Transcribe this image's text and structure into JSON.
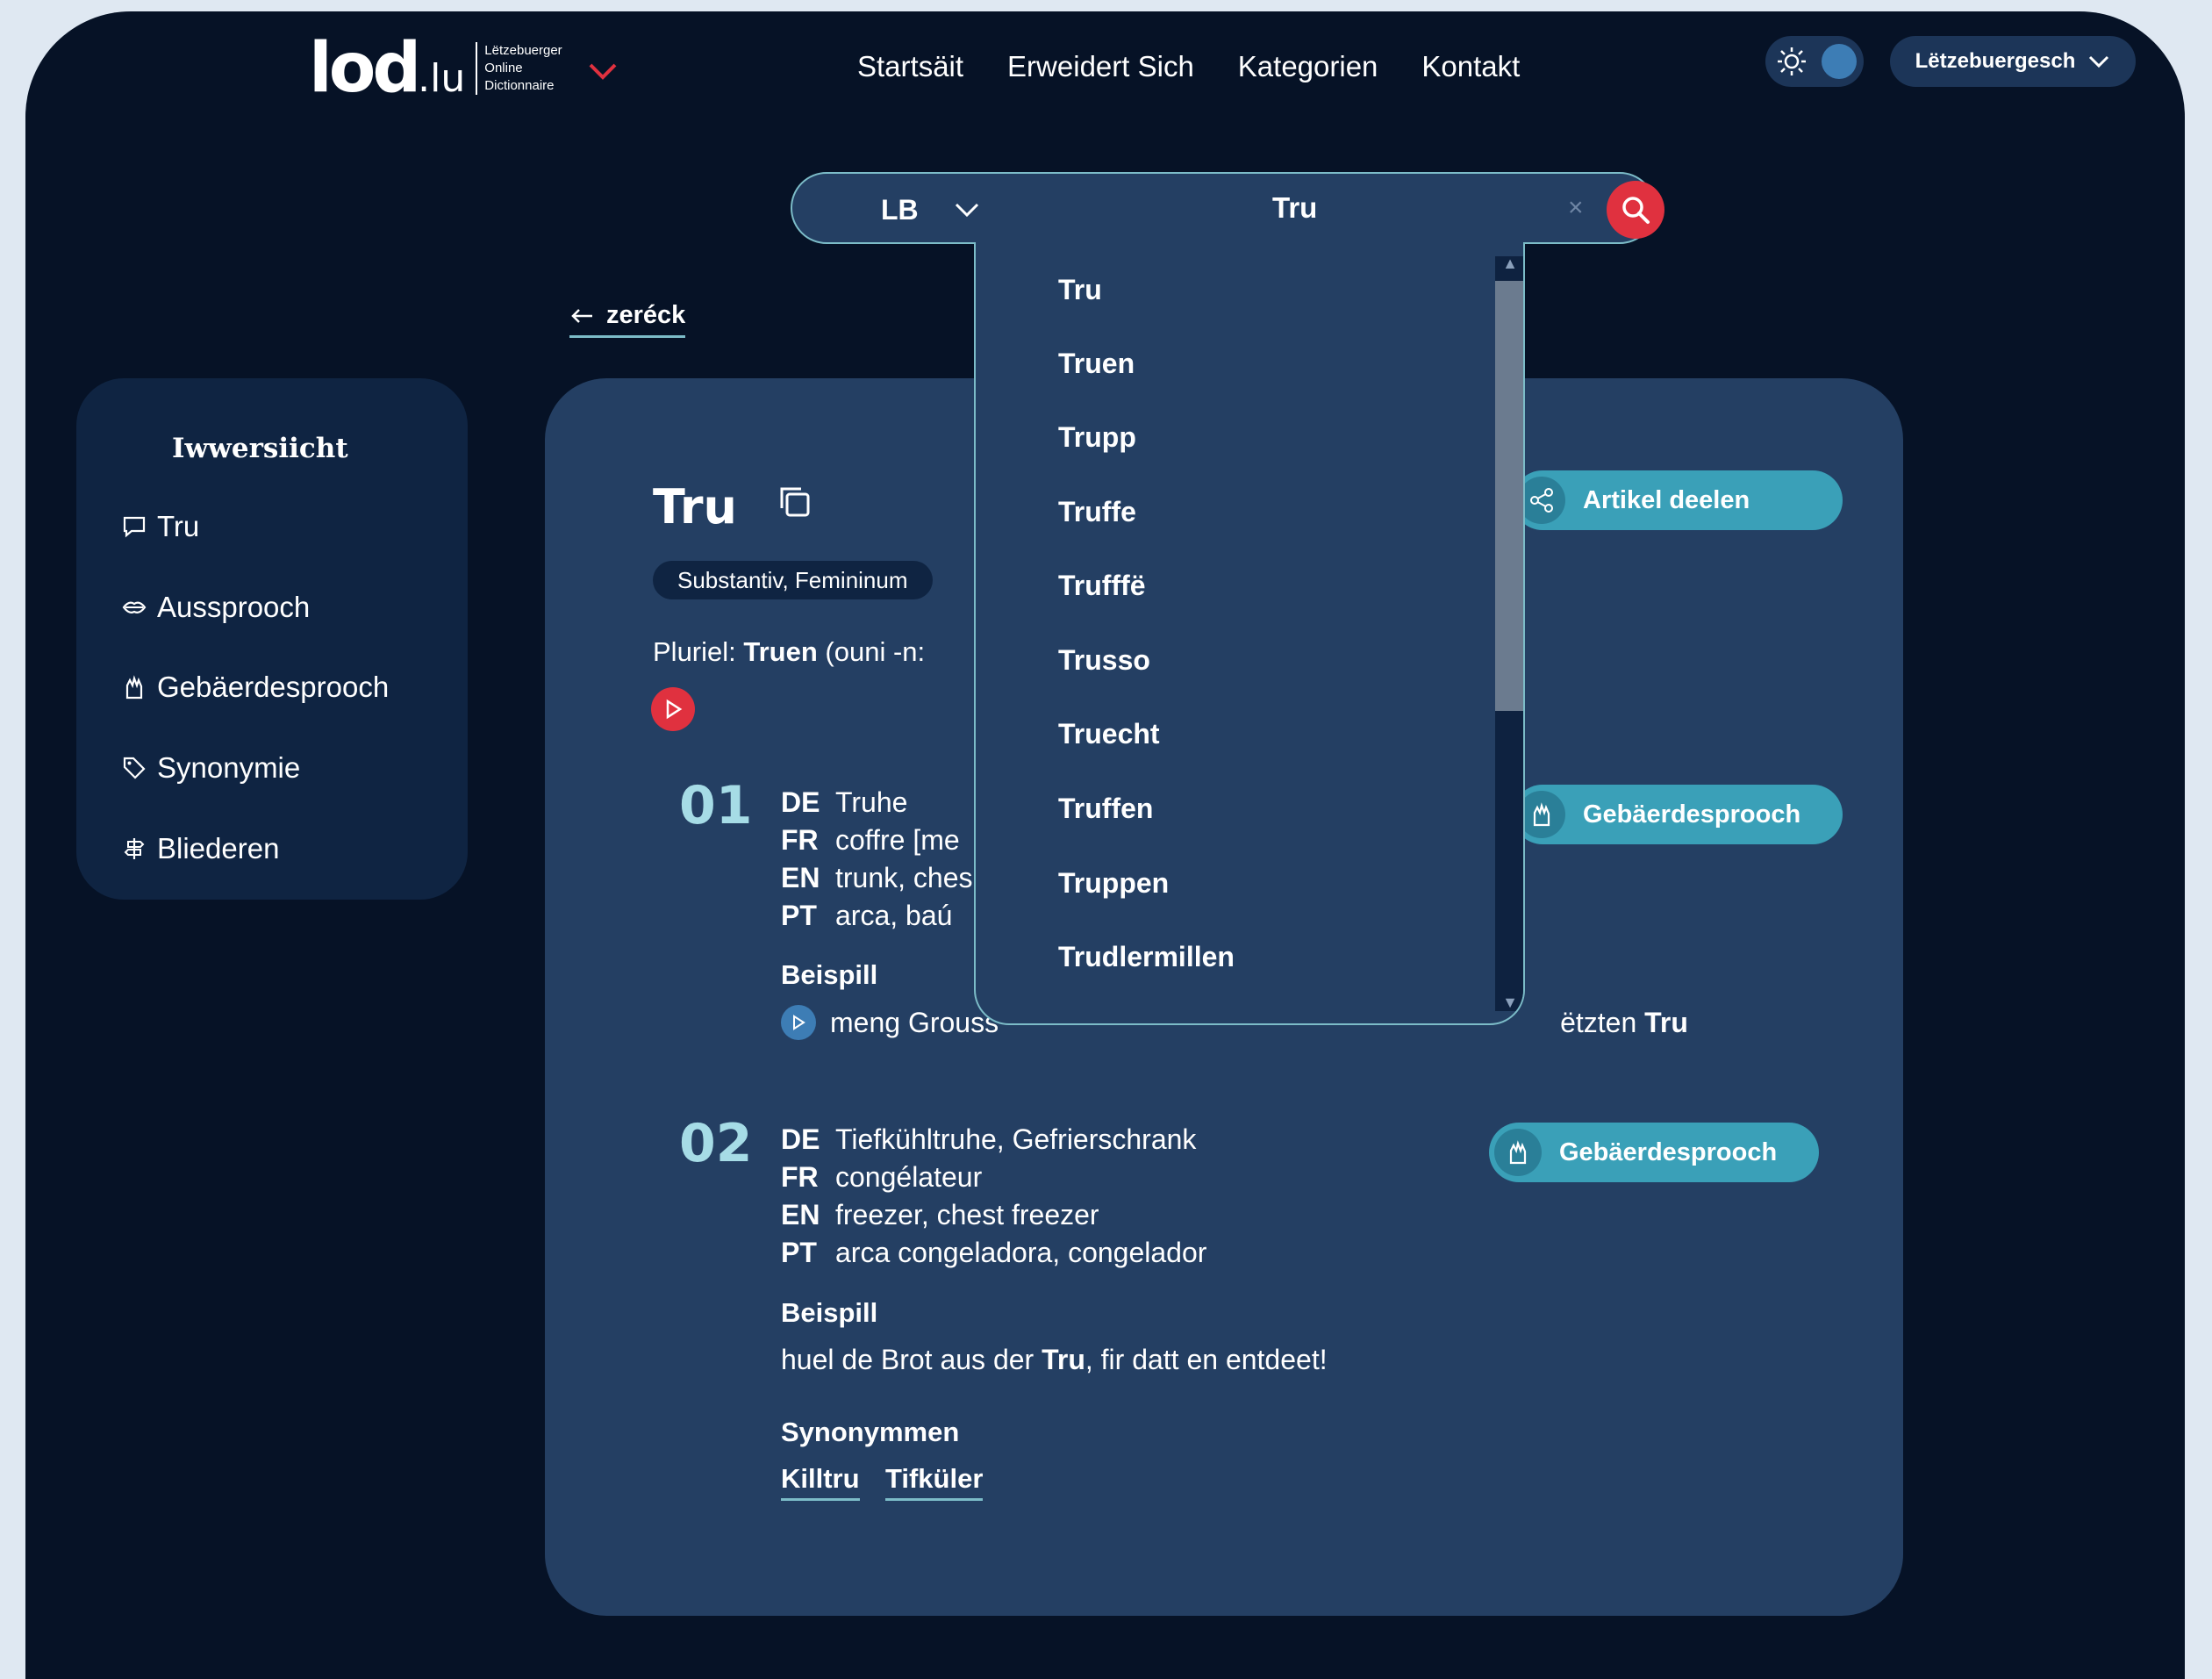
{
  "header": {
    "logo_main": "lod",
    "logo_tld": ".lu",
    "logo_sub": [
      "Lëtzebuerger",
      "Online",
      "Dictionnaire"
    ],
    "nav": [
      "Startsäit",
      "Erweidert Sich",
      "Kategorien",
      "Kontakt"
    ],
    "language": "Lëtzebuergesch"
  },
  "search": {
    "lang": "LB",
    "value": "Tru",
    "clear": "×"
  },
  "back_label": "zeréck",
  "sidebar": {
    "title": "Iwwersiicht",
    "items": [
      "Tru",
      "Aussprooch",
      "Gebäerdesprooch",
      "Synonymie",
      "Bliederen"
    ]
  },
  "entry": {
    "headword": "Tru",
    "pos": "Substantiv, Femininum",
    "plural_prefix": "Pluriel:",
    "plural_word": "Truen",
    "plural_suffix": "(ouni -n:",
    "share_label": "Artikel deelen",
    "senses": [
      {
        "num": "01",
        "sign_label": "Gebäerdesprooch",
        "translations": [
          {
            "lang": "DE",
            "text": "Truhe"
          },
          {
            "lang": "FR",
            "text": "coffre [me"
          },
          {
            "lang": "EN",
            "text": "trunk, ches"
          },
          {
            "lang": "PT",
            "text": "arca, baú"
          }
        ],
        "example_label": "Beispill",
        "example_before": "meng Grouss",
        "example_after": "ëtzten",
        "example_bold": "Tru"
      },
      {
        "num": "02",
        "sign_label": "Gebäerdesprooch",
        "translations": [
          {
            "lang": "DE",
            "text": "Tiefkühltruhe, Gefrierschrank"
          },
          {
            "lang": "FR",
            "text": "congélateur"
          },
          {
            "lang": "EN",
            "text": "freezer, chest freezer"
          },
          {
            "lang": "PT",
            "text": "arca congeladora, congelador"
          }
        ],
        "example_label": "Beispill",
        "example_before": "huel de Brot aus der",
        "example_bold": "Tru",
        "example_after": ", fir datt en entdeet!",
        "synonyms_label": "Synonymmen",
        "synonyms": [
          "Killtru",
          "Tifküler"
        ]
      }
    ]
  },
  "suggestions": [
    "Tru",
    "Truen",
    "Trupp",
    "Truffe",
    "Trufffë",
    "Trusso",
    "Truecht",
    "Truffen",
    "Truppen",
    "Trudlermillen"
  ],
  "colors": {
    "background": "#061226",
    "card": "#243f63",
    "accent": "#3aa0b8",
    "red": "#e0313f"
  }
}
